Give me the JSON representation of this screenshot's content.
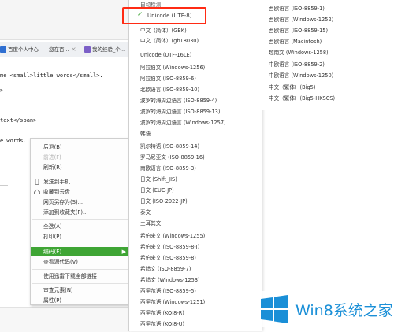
{
  "browser": {
    "tabs": [
      {
        "label": "百度个人中心——您在百..."
      },
      {
        "label": "我的经验_个..."
      }
    ],
    "tab_close": "×",
    "code_lines": [
      "me <small>little words</small>.",
      ">",
      "text</span>",
      "e words."
    ]
  },
  "context_menu": {
    "items": [
      {
        "label": "后退(B)",
        "disabled": false
      },
      {
        "label": "前进(F)",
        "disabled": true
      },
      {
        "label": "刷新(R)",
        "disabled": false
      },
      {
        "label": "发送到手机",
        "icon": "phone-icon"
      },
      {
        "label": "收藏到云盘",
        "icon": "cloud-icon"
      },
      {
        "label": "网页另存为(S)..."
      },
      {
        "label": "添加到收藏夹(F)..."
      },
      {
        "label": "全选(A)"
      },
      {
        "label": "打印(P)..."
      },
      {
        "label": "编码(E)",
        "highlighted": true,
        "arrow": "▶"
      },
      {
        "label": "查看源代码(V)"
      },
      {
        "label": "使用迅雷下载全部链接"
      },
      {
        "label": "审查元素(N)"
      },
      {
        "label": "属性(P)"
      }
    ]
  },
  "encoding_menu": {
    "top_partial": "自动检测",
    "selected": "Unicode (UTF-8)",
    "items": [
      "中文（简体）(GBK)",
      "中文（简体）(gb18030)",
      "Unicode (UTF-16LE)",
      "阿拉伯文 (Windows-1256)",
      "阿拉伯文 (ISO-8859-6)",
      "北欧语言 (ISO-8859-10)",
      "波罗的海周边语言 (ISO-8859-4)",
      "波罗的海周边语言 (ISO-8859-13)",
      "波罗的海周边语言 (Windows-1257)",
      "韩语",
      "凯尔特语 (ISO-8859-14)",
      "罗马尼亚文 (ISO-8859-16)",
      "南欧语言 (ISO-8859-3)",
      "日文 (Shift_JIS)",
      "日文 (EUC-JP)",
      "日文 (ISO-2022-JP)",
      "泰文",
      "土耳其文",
      "希伯来文 (Windows-1255)",
      "希伯来文 (ISO-8859-8-I)",
      "希伯来文 (ISO-8859-8)",
      "希腊文 (ISO-8859-7)",
      "希腊文 (Windows-1253)",
      "西里尔语 (ISO-8859-5)",
      "西里尔语 (Windows-1251)",
      "西里尔语 (KOI8-R)",
      "西里尔语 (KOI8-U)"
    ],
    "column2": [
      "西欧语言 (ISO-8859-1)",
      "西欧语言 (Windows-1252)",
      "西欧语言 (ISO-8859-15)",
      "西欧语言 (Macintosh)",
      "越南文 (Windows-1258)",
      "中欧语言 (ISO-8859-2)",
      "中欧语言 (Windows-1250)",
      "中文（繁体）(Big5)",
      "中文（繁体）(Big5-HKSCS)"
    ]
  },
  "watermark": {
    "text": "Win8系统之家",
    "color": "#1a8fd7"
  },
  "colors": {
    "accent": "#3fa535",
    "highlight_box": "#ff2b14"
  }
}
